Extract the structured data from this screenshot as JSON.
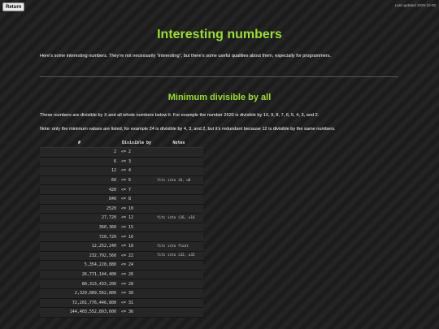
{
  "header": {
    "return_label": "Return",
    "last_updated": "Last updated 2025-10-00"
  },
  "page": {
    "title": "Interesting numbers",
    "intro": "Here's some interesting numbers. They're not necessarily \"interesting\", but there's some useful qualities about them, especially for programmers."
  },
  "section": {
    "title": "Minimum divisible by all",
    "description": "These numbers are divisible by X and all whole numbers below it. For example the number 2520 is divisible by 10, 9, 8, 7, 6, 5, 4, 3, and 2.",
    "note": "Note: only the minimum values are listed, for example 24 is divisible by 4, 3, and 2, but it's redundant because 12 is divisible by the same numbers."
  },
  "table": {
    "headers": {
      "number": "#",
      "divisible": "Divisible by",
      "notes": "Notes"
    },
    "rows": [
      {
        "number": "2",
        "divisible": "<= 2",
        "notes": ""
      },
      {
        "number": "6",
        "divisible": "<= 3",
        "notes": ""
      },
      {
        "number": "12",
        "divisible": "<= 4",
        "notes": ""
      },
      {
        "number": "60",
        "divisible": "<= 6",
        "notes": "fits into i8, u8"
      },
      {
        "number": "420",
        "divisible": "<= 7",
        "notes": ""
      },
      {
        "number": "840",
        "divisible": "<= 8",
        "notes": ""
      },
      {
        "number": "2520",
        "divisible": "<= 10",
        "notes": ""
      },
      {
        "number": "27,720",
        "divisible": "<= 12",
        "notes": "fits into i16, u16"
      },
      {
        "number": "360,360",
        "divisible": "<= 15",
        "notes": ""
      },
      {
        "number": "720,720",
        "divisible": "<= 16",
        "notes": ""
      },
      {
        "number": "12,252,240",
        "divisible": "<= 18",
        "notes": "fits into float"
      },
      {
        "number": "232,792,560",
        "divisible": "<= 22",
        "notes": "fits into i32, u32"
      },
      {
        "number": "5,354,228,880",
        "divisible": "<= 24",
        "notes": ""
      },
      {
        "number": "26,771,144,400",
        "divisible": "<= 26",
        "notes": ""
      },
      {
        "number": "80,313,433,200",
        "divisible": "<= 28",
        "notes": ""
      },
      {
        "number": "2,329,089,562,800",
        "divisible": "<= 30",
        "notes": ""
      },
      {
        "number": "72,201,776,446,800",
        "divisible": "<= 31",
        "notes": ""
      },
      {
        "number": "144,403,552,893,600",
        "divisible": "<= 36",
        "notes": ""
      }
    ]
  }
}
